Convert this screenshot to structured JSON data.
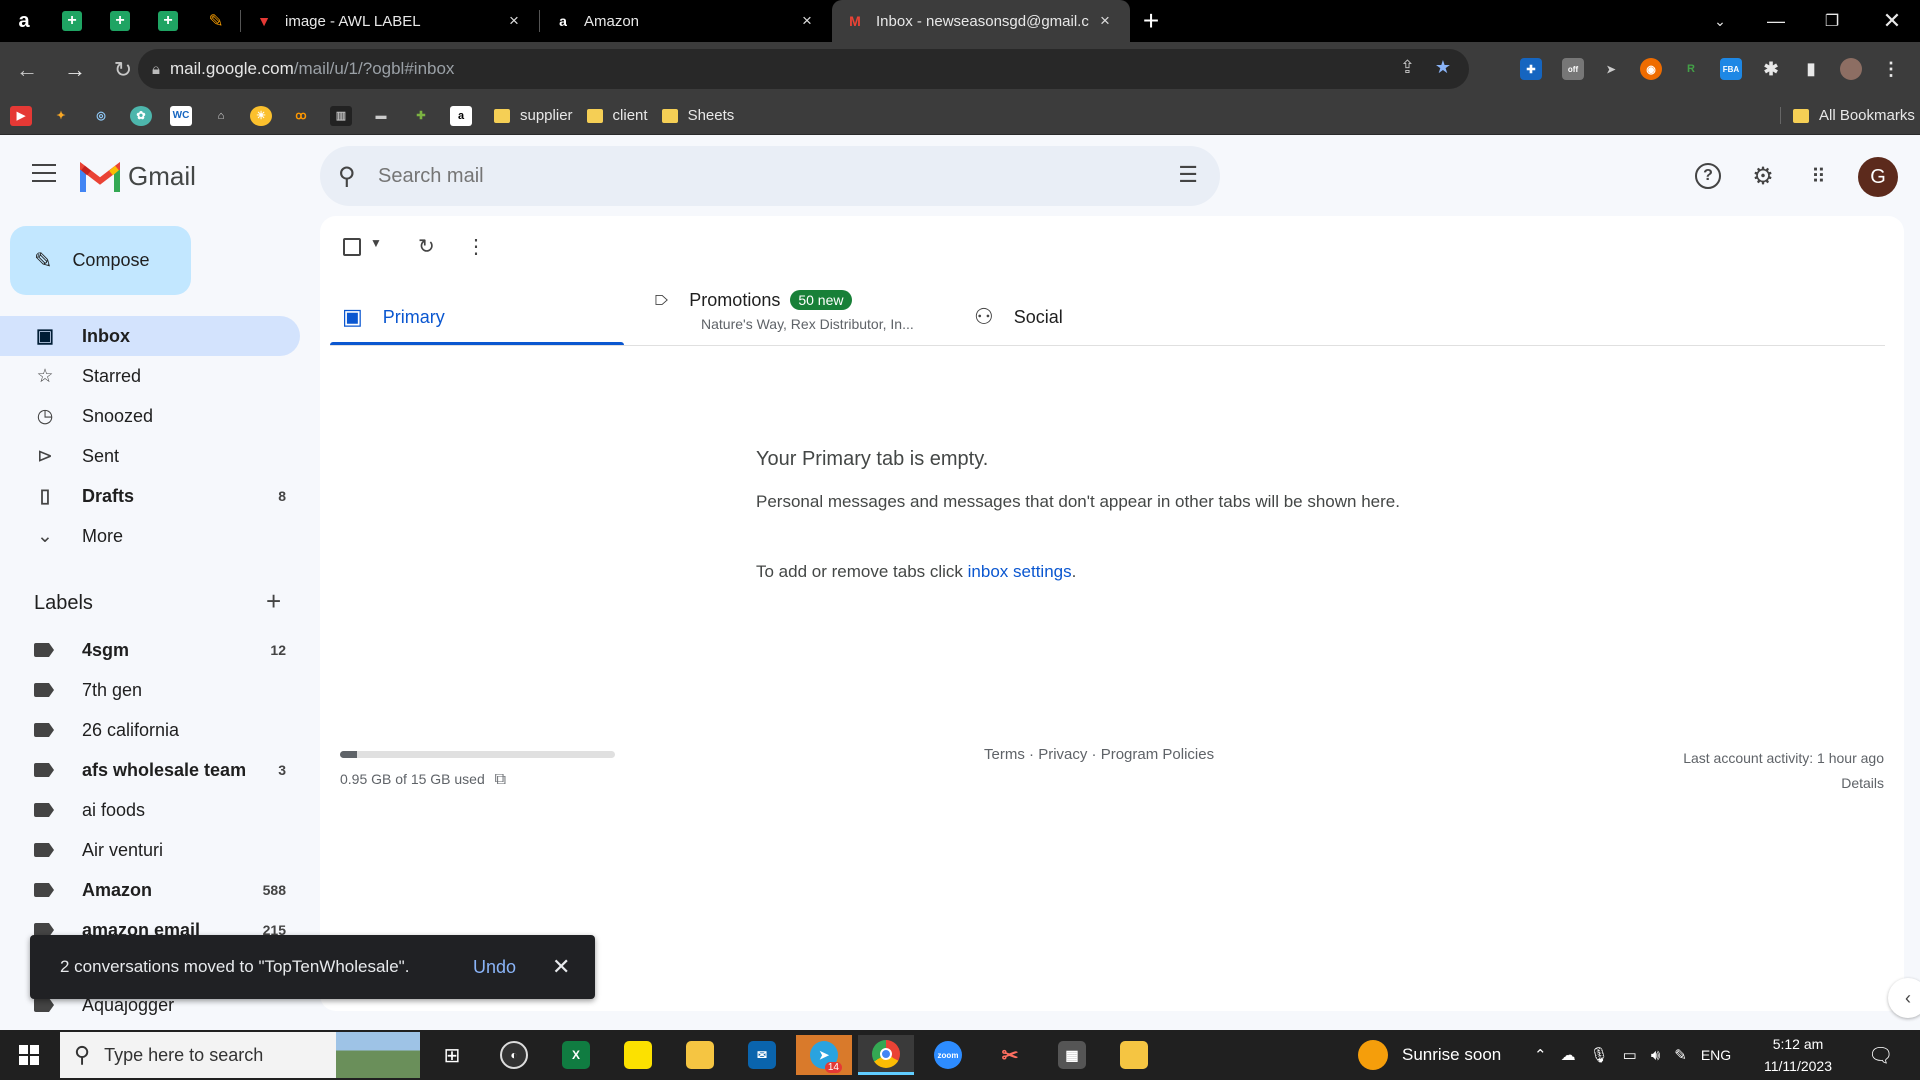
{
  "browser": {
    "tabs": [
      {
        "title": "image - AWL LABEL",
        "close": "×"
      },
      {
        "title": "Amazon",
        "close": "×"
      },
      {
        "title": "Inbox - newseasonsgd@gmail.c",
        "close": "×"
      }
    ],
    "new_tab": "+",
    "url_host": "mail.google.com",
    "url_path": "/mail/u/1/?ogbl#inbox",
    "ext_off_badge": "off",
    "bookmarks": [
      {
        "label": "supplier"
      },
      {
        "label": "client"
      },
      {
        "label": "Sheets"
      }
    ],
    "all_bookmarks": "All Bookmarks"
  },
  "gmail": {
    "logo_text": "Gmail",
    "search_placeholder": "Search mail",
    "avatar_letter": "G",
    "compose_label": "Compose",
    "nav": [
      {
        "label": "Inbox",
        "count": ""
      },
      {
        "label": "Starred",
        "count": ""
      },
      {
        "label": "Snoozed",
        "count": ""
      },
      {
        "label": "Sent",
        "count": ""
      },
      {
        "label": "Drafts",
        "count": "8"
      },
      {
        "label": "More",
        "count": ""
      }
    ],
    "labels_heading": "Labels",
    "labels": [
      {
        "label": "4sgm",
        "count": "12"
      },
      {
        "label": "7th gen",
        "count": ""
      },
      {
        "label": "26 california",
        "count": ""
      },
      {
        "label": "afs wholesale team",
        "count": "3"
      },
      {
        "label": "ai foods",
        "count": ""
      },
      {
        "label": "Air venturi",
        "count": ""
      },
      {
        "label": "Amazon",
        "count": "588"
      },
      {
        "label": "amazon email",
        "count": "215"
      },
      {
        "label": "Aquajogger",
        "count": ""
      }
    ],
    "tabs": {
      "primary": "Primary",
      "promotions": "Promotions",
      "promotions_badge": "50 new",
      "promotions_sub": "Nature's Way, Rex Distributor, In...",
      "social": "Social"
    },
    "empty": {
      "title": "Your Primary tab is empty.",
      "body": "Personal messages and messages that don't appear in other tabs will be shown here.",
      "settings_prefix": "To add or remove tabs click ",
      "settings_link": "inbox settings",
      "settings_suffix": "."
    },
    "storage": {
      "text": "0.95 GB of 15 GB used",
      "fraction": 0.063
    },
    "footer": {
      "terms": "Terms",
      "privacy": "Privacy",
      "policies": "Program Policies",
      "sep": " · "
    },
    "activity": {
      "text": "Last account activity: 1 hour ago",
      "details": "Details"
    },
    "snackbar": {
      "message": "2 conversations moved to \"TopTenWholesale\".",
      "undo": "Undo"
    }
  },
  "taskbar": {
    "search_placeholder": "Type here to search",
    "telegram_badge": "14",
    "weather": "Sunrise soon",
    "lang": "ENG",
    "time": "5:12 am",
    "date": "11/11/2023"
  },
  "colors": {
    "accent": "#0b57d0",
    "compose_bg": "#c2e7ff",
    "active_nav": "#d3e3fd",
    "badge_green": "#188038"
  }
}
